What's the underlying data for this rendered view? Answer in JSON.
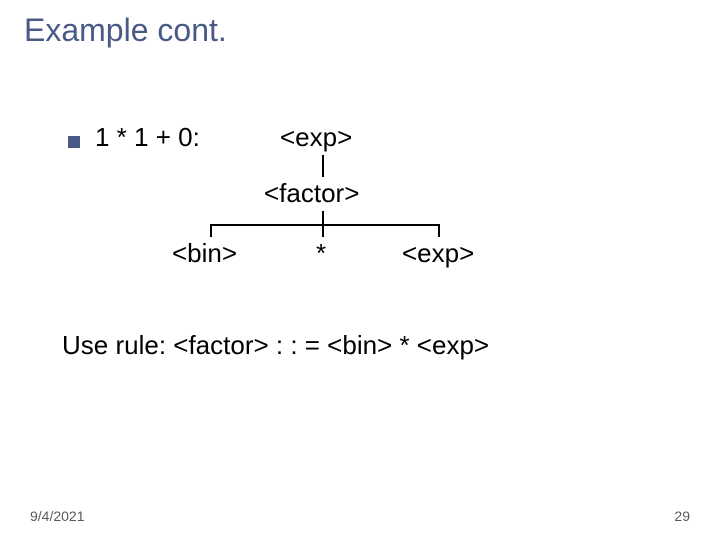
{
  "title": "Example cont.",
  "expr": "1 * 1 + 0:",
  "n1": "<exp>",
  "n2": "<factor>",
  "c1": "<bin>",
  "c2": "*",
  "c3": "<exp>",
  "rule": "Use rule:  <factor>  : : =  <bin> *  <exp>",
  "date": "9/4/2021",
  "page": "29"
}
